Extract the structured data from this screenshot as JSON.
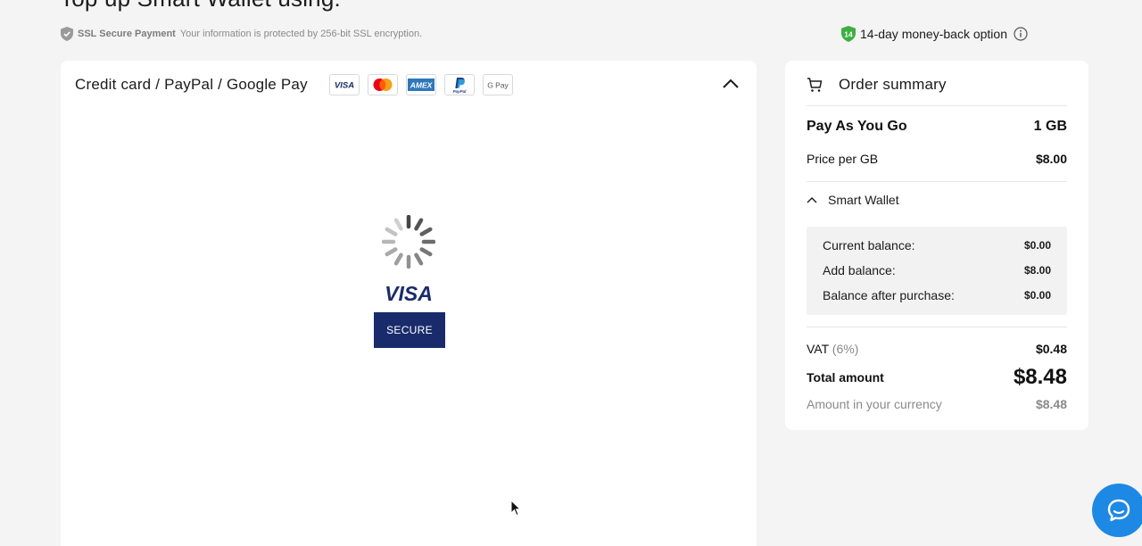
{
  "page": {
    "heading": "Top up Smart Wallet using:"
  },
  "ssl": {
    "title": "SSL Secure Payment",
    "text": "Your information is protected by 256-bit SSL encryption.",
    "icon": "shield-icon"
  },
  "moneyback": {
    "badge_number": "14",
    "label": "14-day money-back option",
    "icon": "info-icon",
    "badge_color": "#3cb043"
  },
  "payment": {
    "title": "Credit card / PayPal / Google Pay",
    "brands": [
      {
        "name": "VISA",
        "icon": "visa-logo"
      },
      {
        "name": "Mastercard",
        "icon": "mastercard-logo"
      },
      {
        "name": "AMEX",
        "icon": "amex-logo"
      },
      {
        "name": "PayPal",
        "icon": "paypal-logo"
      },
      {
        "name": "G Pay",
        "icon": "gpay-logo"
      }
    ],
    "loading_brand": "VISA",
    "secure_label": "SECURE",
    "secure_color": "#1a2b6b"
  },
  "summary": {
    "title": "Order summary",
    "plan_name": "Pay As You Go",
    "plan_amount": "1 GB",
    "price_label": "Price per GB",
    "price_value": "$8.00",
    "wallet_label": "Smart Wallet",
    "wallet": {
      "rows": [
        {
          "label": "Current balance:",
          "value": "$0.00"
        },
        {
          "label": "Add balance:",
          "value": "$8.00"
        },
        {
          "label": "Balance after purchase:",
          "value": "$0.00"
        }
      ]
    },
    "vat_label": "VAT",
    "vat_pct": "(6%)",
    "vat_value": "$0.48",
    "total_label": "Total amount",
    "total_value": "$8.48",
    "currency_label": "Amount in your currency",
    "currency_value": "$8.48"
  },
  "chat": {
    "icon": "chat-bubble-icon",
    "color": "#1e88e5"
  }
}
